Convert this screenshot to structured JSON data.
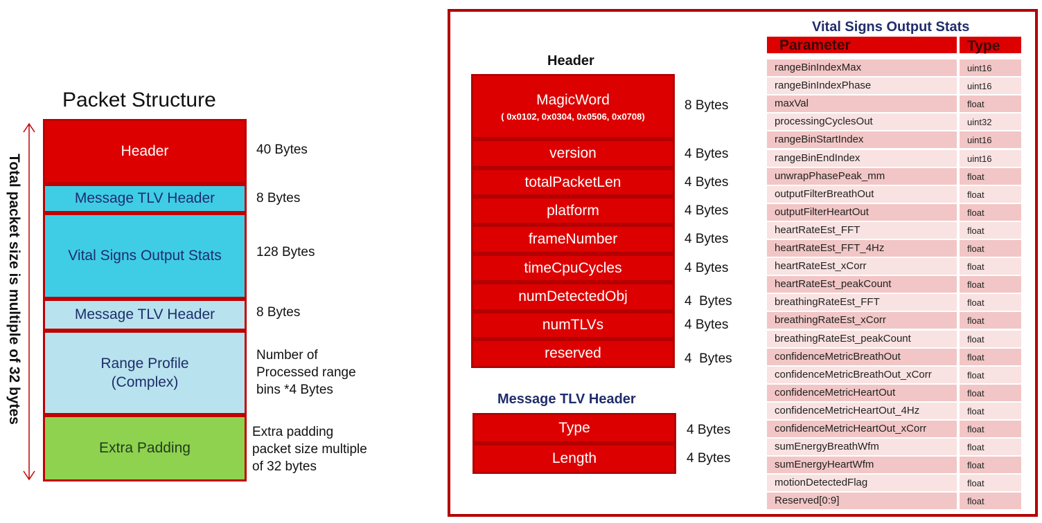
{
  "packet": {
    "title": "Packet Structure",
    "side_label": "Total packet size is multiple of 32 bytes",
    "blocks": [
      {
        "name": "Header",
        "size": "40 Bytes"
      },
      {
        "name": "Message TLV Header",
        "size": "8 Bytes"
      },
      {
        "name": "Vital Signs Output Stats",
        "size": "128 Bytes"
      },
      {
        "name": "Message TLV Header",
        "size": "8 Bytes"
      },
      {
        "name_line1": "Range Profile",
        "name_line2": "(Complex)",
        "size_line1": "Number of",
        "size_line2": "Processed range",
        "size_line3": "bins *4 Bytes"
      },
      {
        "name": "Extra Padding",
        "size_line1": "Extra padding",
        "size_line2": "packet size multiple",
        "size_line3": "of 32 bytes"
      }
    ]
  },
  "header": {
    "title": "Header",
    "fields": [
      {
        "name": "MagicWord",
        "sub": "( 0x0102, 0x0304, 0x0506, 0x0708)",
        "size": "8 Bytes"
      },
      {
        "name": "version",
        "size": "4 Bytes"
      },
      {
        "name": "totalPacketLen",
        "size": "4 Bytes"
      },
      {
        "name": "platform",
        "size": "4 Bytes"
      },
      {
        "name": "frameNumber",
        "size": "4 Bytes"
      },
      {
        "name": "timeCpuCycles",
        "size": "4 Bytes"
      },
      {
        "name": "numDetectedObj",
        "size": "4  Bytes"
      },
      {
        "name": "numTLVs",
        "size": "4 Bytes"
      },
      {
        "name": "reserved",
        "size": "4  Bytes"
      }
    ]
  },
  "tlv": {
    "title": "Message TLV Header",
    "fields": [
      {
        "name": "Type",
        "size": "4 Bytes"
      },
      {
        "name": "Length",
        "size": "4 Bytes"
      }
    ]
  },
  "stats": {
    "title": "Vital Signs Output Stats",
    "col_param": "Parameter",
    "col_type": "Type",
    "rows": [
      {
        "p": "rangeBinIndexMax",
        "t": "uint16"
      },
      {
        "p": "rangeBinIndexPhase",
        "t": "uint16"
      },
      {
        "p": "maxVal",
        "t": "float"
      },
      {
        "p": "processingCyclesOut",
        "t": "uint32"
      },
      {
        "p": "rangeBinStartIndex",
        "t": "uint16"
      },
      {
        "p": "rangeBinEndIndex",
        "t": "uint16"
      },
      {
        "p": "unwrapPhasePeak_mm",
        "t": "float"
      },
      {
        "p": "outputFilterBreathOut",
        "t": "float"
      },
      {
        "p": "outputFilterHeartOut",
        "t": "float"
      },
      {
        "p": "heartRateEst_FFT",
        "t": "float"
      },
      {
        "p": "heartRateEst_FFT_4Hz",
        "t": "float"
      },
      {
        "p": "heartRateEst_xCorr",
        "t": "float"
      },
      {
        "p": "heartRateEst_peakCount",
        "t": "float"
      },
      {
        "p": "breathingRateEst_FFT",
        "t": "float"
      },
      {
        "p": "breathingRateEst_xCorr",
        "t": "float"
      },
      {
        "p": "breathingRateEst_peakCount",
        "t": "float"
      },
      {
        "p": "confidenceMetricBreathOut",
        "t": "float"
      },
      {
        "p": "confidenceMetricBreathOut_xCorr",
        "t": "float"
      },
      {
        "p": "confidenceMetricHeartOut",
        "t": "float"
      },
      {
        "p": "confidenceMetricHeartOut_4Hz",
        "t": "float"
      },
      {
        "p": "confidenceMetricHeartOut_xCorr",
        "t": "float"
      },
      {
        "p": "sumEnergyBreathWfm",
        "t": "float"
      },
      {
        "p": "sumEnergyHeartWfm",
        "t": "float"
      },
      {
        "p": "motionDetectedFlag",
        "t": "float"
      },
      {
        "p": "Reserved[0:9]",
        "t": "float"
      }
    ]
  }
}
